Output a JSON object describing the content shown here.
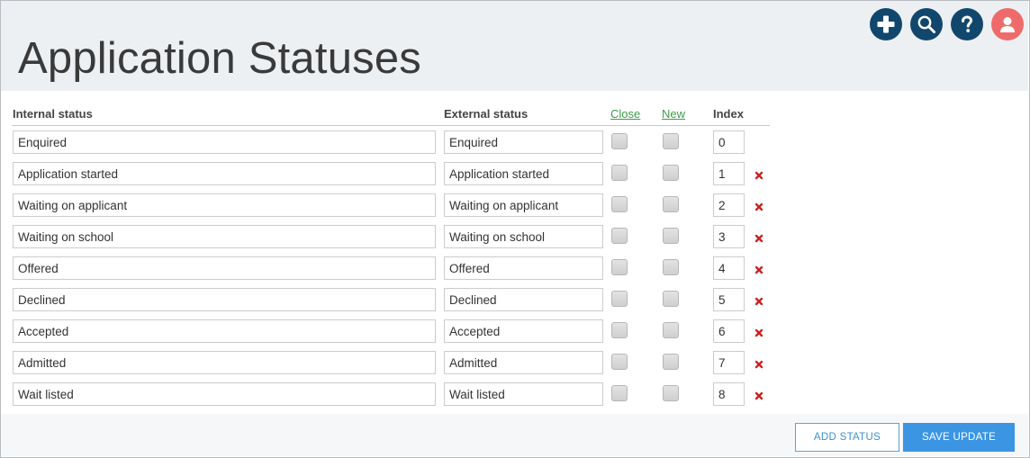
{
  "page": {
    "title": "Application Statuses"
  },
  "top_icons": [
    {
      "name": "add-icon",
      "color": "#12476d"
    },
    {
      "name": "search-icon",
      "color": "#12476d"
    },
    {
      "name": "help-icon",
      "color": "#12476d"
    },
    {
      "name": "user-icon",
      "color": "#ef6b6b"
    }
  ],
  "columns": {
    "internal": "Internal status",
    "external": "External status",
    "close": "Close",
    "new": "New",
    "index": "Index"
  },
  "rows": [
    {
      "internal": "Enquired",
      "external": "Enquired",
      "close": false,
      "new": false,
      "index": "0",
      "deletable": false
    },
    {
      "internal": "Application started",
      "external": "Application started",
      "close": false,
      "new": false,
      "index": "1",
      "deletable": true
    },
    {
      "internal": "Waiting on applicant",
      "external": "Waiting on applicant",
      "close": false,
      "new": false,
      "index": "2",
      "deletable": true
    },
    {
      "internal": "Waiting on school",
      "external": "Waiting on school",
      "close": false,
      "new": false,
      "index": "3",
      "deletable": true
    },
    {
      "internal": "Offered",
      "external": "Offered",
      "close": false,
      "new": false,
      "index": "4",
      "deletable": true
    },
    {
      "internal": "Declined",
      "external": "Declined",
      "close": false,
      "new": false,
      "index": "5",
      "deletable": true
    },
    {
      "internal": "Accepted",
      "external": "Accepted",
      "close": false,
      "new": false,
      "index": "6",
      "deletable": true
    },
    {
      "internal": "Admitted",
      "external": "Admitted",
      "close": false,
      "new": false,
      "index": "7",
      "deletable": true
    },
    {
      "internal": "Wait listed",
      "external": "Wait listed",
      "close": false,
      "new": false,
      "index": "8",
      "deletable": true
    }
  ],
  "buttons": {
    "add_status": "ADD STATUS",
    "save_update": "SAVE UPDATE"
  },
  "colors": {
    "accent": "#3c95e3",
    "link": "#3f9c4c",
    "delete": "#cc2222",
    "header_bg": "#edf0f3"
  }
}
